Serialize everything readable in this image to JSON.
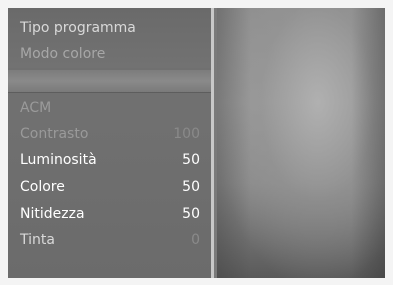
{
  "menu": {
    "items": [
      {
        "label": "Tipo programma",
        "value": ""
      },
      {
        "label": "Modo colore",
        "value": ""
      },
      {
        "label": "ACM",
        "value": ""
      },
      {
        "label": "Contrasto",
        "value": "100"
      },
      {
        "label": "Luminosità",
        "value": "50"
      },
      {
        "label": "Colore",
        "value": "50"
      },
      {
        "label": "Nitidezza",
        "value": "50"
      },
      {
        "label": "Tinta",
        "value": "0"
      }
    ]
  }
}
